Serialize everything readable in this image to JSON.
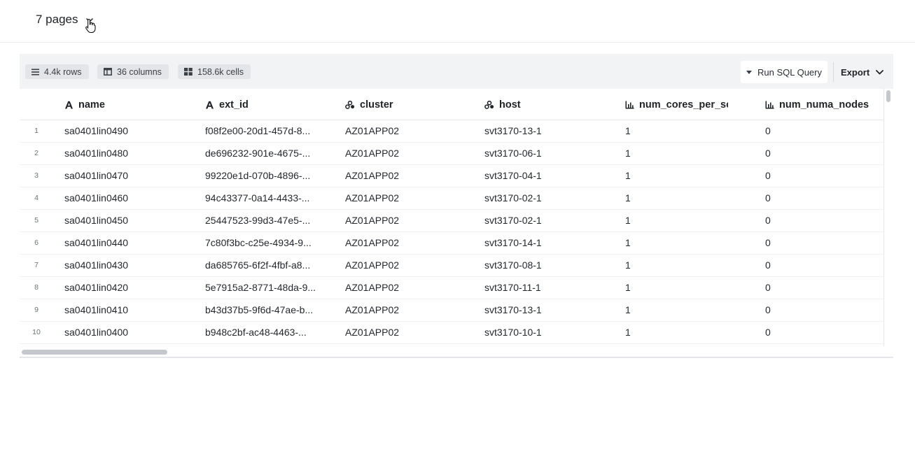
{
  "header": {
    "pages_label": "7 pages"
  },
  "toolbar": {
    "rows_label": "4.4k rows",
    "columns_label": "36 columns",
    "cells_label": "158.6k cells",
    "sql_button_label": "Run SQL Query",
    "export_button_label": "Export"
  },
  "table": {
    "columns": [
      {
        "label": "name",
        "icon": "text-type-icon"
      },
      {
        "label": "ext_id",
        "icon": "text-type-icon"
      },
      {
        "label": "cluster",
        "icon": "category-type-icon"
      },
      {
        "label": "host",
        "icon": "category-type-icon"
      },
      {
        "label": "num_cores_per_sc",
        "icon": "numeric-type-icon"
      },
      {
        "label": "num_numa_nodes",
        "icon": "numeric-type-icon"
      }
    ],
    "rows": [
      {
        "index": "1",
        "name": "sa0401lin0490",
        "ext_id": "f08f2e00-20d1-457d-8...",
        "cluster": "AZ01APP02",
        "host": "svt3170-13-1",
        "num_cores_per_sc": "1",
        "num_numa_nodes": "0"
      },
      {
        "index": "2",
        "name": "sa0401lin0480",
        "ext_id": "de696232-901e-4675-...",
        "cluster": "AZ01APP02",
        "host": "svt3170-06-1",
        "num_cores_per_sc": "1",
        "num_numa_nodes": "0"
      },
      {
        "index": "3",
        "name": "sa0401lin0470",
        "ext_id": "99220e1d-070b-4896-...",
        "cluster": "AZ01APP02",
        "host": "svt3170-04-1",
        "num_cores_per_sc": "1",
        "num_numa_nodes": "0"
      },
      {
        "index": "4",
        "name": "sa0401lin0460",
        "ext_id": "94c43377-0a14-4433-...",
        "cluster": "AZ01APP02",
        "host": "svt3170-02-1",
        "num_cores_per_sc": "1",
        "num_numa_nodes": "0"
      },
      {
        "index": "5",
        "name": "sa0401lin0450",
        "ext_id": "25447523-99d3-47e5-...",
        "cluster": "AZ01APP02",
        "host": "svt3170-02-1",
        "num_cores_per_sc": "1",
        "num_numa_nodes": "0"
      },
      {
        "index": "6",
        "name": "sa0401lin0440",
        "ext_id": "7c80f3bc-c25e-4934-9...",
        "cluster": "AZ01APP02",
        "host": "svt3170-14-1",
        "num_cores_per_sc": "1",
        "num_numa_nodes": "0"
      },
      {
        "index": "7",
        "name": "sa0401lin0430",
        "ext_id": "da685765-6f2f-4fbf-a8...",
        "cluster": "AZ01APP02",
        "host": "svt3170-08-1",
        "num_cores_per_sc": "1",
        "num_numa_nodes": "0"
      },
      {
        "index": "8",
        "name": "sa0401lin0420",
        "ext_id": "5e7915a2-8771-48da-9...",
        "cluster": "AZ01APP02",
        "host": "svt3170-11-1",
        "num_cores_per_sc": "1",
        "num_numa_nodes": "0"
      },
      {
        "index": "9",
        "name": "sa0401lin0410",
        "ext_id": "b43d37b5-9f6d-47ae-b...",
        "cluster": "AZ01APP02",
        "host": "svt3170-13-1",
        "num_cores_per_sc": "1",
        "num_numa_nodes": "0"
      },
      {
        "index": "10",
        "name": "sa0401lin0400",
        "ext_id": "b948c2bf-ac48-4463-...",
        "cluster": "AZ01APP02",
        "host": "svt3170-10-1",
        "num_cores_per_sc": "1",
        "num_numa_nodes": "0"
      }
    ]
  },
  "colors": {
    "toolbar_bg": "#f2f3f5",
    "pill_bg": "#e3e5e9",
    "text": "#1f2328"
  }
}
